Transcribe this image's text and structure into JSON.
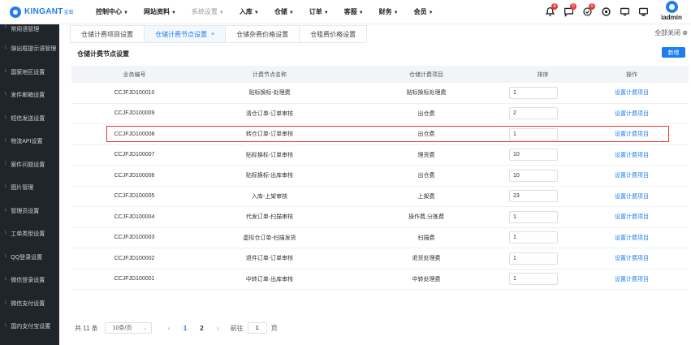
{
  "brand": {
    "name": "KINGANT",
    "sub": "金蚁"
  },
  "nav": [
    {
      "label": "控制中心",
      "dim": false
    },
    {
      "label": "网站资料",
      "dim": false
    },
    {
      "label": "系统设置",
      "dim": true
    },
    {
      "label": "入库",
      "dim": false
    },
    {
      "label": "仓储",
      "dim": false
    },
    {
      "label": "订单",
      "dim": false
    },
    {
      "label": "客服",
      "dim": false
    },
    {
      "label": "财务",
      "dim": false
    },
    {
      "label": "会员",
      "dim": false
    }
  ],
  "top_icons": [
    {
      "name": "bell-icon",
      "badge": "8"
    },
    {
      "name": "message-icon",
      "badge": "0"
    },
    {
      "name": "task-icon",
      "badge": "0"
    },
    {
      "name": "settings-icon",
      "badge": ""
    },
    {
      "name": "chat-icon",
      "badge": ""
    },
    {
      "name": "monitor-icon",
      "badge": ""
    }
  ],
  "user": {
    "name": "iadmin"
  },
  "sidebar": [
    "常用语管理",
    "弹出框提示语管理",
    "国家地区设置",
    "发件邮箱设置",
    "短信发送设置",
    "物流API设置",
    "案件问题设置",
    "图片管理",
    "管理员设置",
    "工单类型设置",
    "QQ登录设置",
    "微信登录设置",
    "微信支付设置",
    "国内支付宝设置"
  ],
  "tabs": [
    {
      "label": "仓储计费项目设置",
      "active": false,
      "closable": false
    },
    {
      "label": "仓储计费节点设置",
      "active": true,
      "closable": true
    },
    {
      "label": "仓储杂费价格设置",
      "active": false,
      "closable": false
    },
    {
      "label": "仓租费价格设置",
      "active": false,
      "closable": false
    }
  ],
  "tab_close_glyph": "×",
  "close_all": "全部关闭 ⊗",
  "content": {
    "title": "仓储计费节点设置",
    "new_button": "新增"
  },
  "table": {
    "headers": [
      "业务编号",
      "计费节点名称",
      "仓储计费项目",
      "排序",
      "操作"
    ],
    "rows": [
      {
        "code": "CCJFJD100010",
        "node": "贴标换标-处理费",
        "item": "贴标换标处理费",
        "sort": "1",
        "action": "设置计费项目"
      },
      {
        "code": "CCJFJD100009",
        "node": "清仓订单-订单审核",
        "item": "出仓费",
        "sort": "2",
        "action": "设置计费项目"
      },
      {
        "code": "CCJFJD100008",
        "node": "转仓订单-订单审核",
        "item": "出仓费",
        "sort": "1",
        "action": "设置计费项目"
      },
      {
        "code": "CCJFJD100007",
        "node": "贴标换标-订单审核",
        "item": "理货费",
        "sort": "10",
        "action": "设置计费项目"
      },
      {
        "code": "CCJFJD100006",
        "node": "贴标换标-出库审核",
        "item": "出仓费",
        "sort": "10",
        "action": "设置计费项目"
      },
      {
        "code": "CCJFJD100005",
        "node": "入库-上架审核",
        "item": "上架费",
        "sort": "23",
        "action": "设置计费项目"
      },
      {
        "code": "CCJFJD100004",
        "node": "代发订单-扫描审核",
        "item": "操作费,分拣费",
        "sort": "1",
        "action": "设置计费项目"
      },
      {
        "code": "CCJFJD100003",
        "node": "虚拟仓订单-扫描发货",
        "item": "扫描费",
        "sort": "1",
        "action": "设置计费项目"
      },
      {
        "code": "CCJFJD100002",
        "node": "退件订单-订单审核",
        "item": "退货处理费",
        "sort": "1",
        "action": "设置计费项目"
      },
      {
        "code": "CCJFJD100001",
        "node": "中转订单-出库审核",
        "item": "中转处理费",
        "sort": "1",
        "action": "设置计费项目"
      }
    ]
  },
  "pagination": {
    "total": "共 11 条",
    "page_size": "10条/页",
    "pages": [
      "1",
      "2"
    ],
    "current": "1",
    "goto_label": "前往",
    "goto_value": "1",
    "page_unit": "页"
  }
}
